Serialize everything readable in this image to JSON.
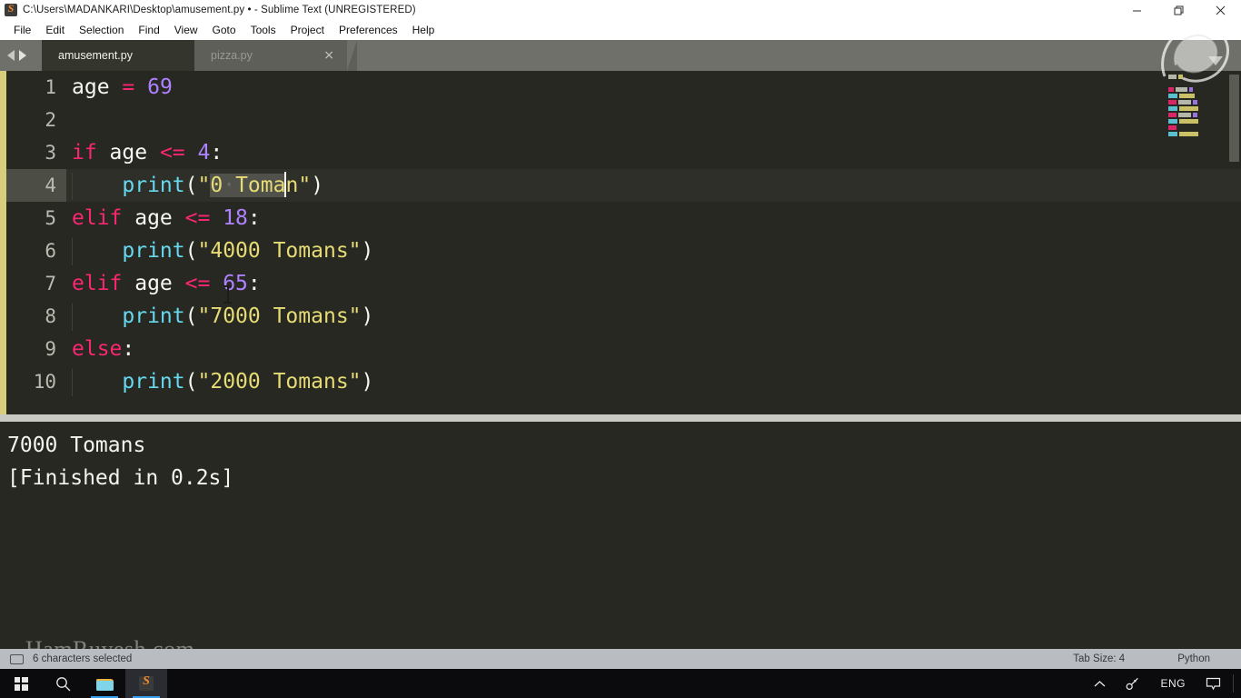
{
  "window": {
    "title": "C:\\Users\\MADANKARI\\Desktop\\amusement.py • - Sublime Text (UNREGISTERED)",
    "app_icon": "sublime-text-icon",
    "controls": {
      "minimize": "minimize-icon",
      "restore": "restore-icon",
      "close": "close-icon"
    }
  },
  "menubar": {
    "items": [
      {
        "label": "File"
      },
      {
        "label": "Edit"
      },
      {
        "label": "Selection"
      },
      {
        "label": "Find"
      },
      {
        "label": "View"
      },
      {
        "label": "Goto"
      },
      {
        "label": "Tools"
      },
      {
        "label": "Project"
      },
      {
        "label": "Preferences"
      },
      {
        "label": "Help"
      }
    ]
  },
  "tabbar": {
    "nav": {
      "prev": "arrow-left-icon",
      "next": "arrow-right-icon"
    },
    "tabs": [
      {
        "label": "amusement.py",
        "active": true,
        "modified": true,
        "close_glyph": ""
      },
      {
        "label": "pizza.py",
        "active": false,
        "modified": false,
        "close_glyph": "×"
      }
    ]
  },
  "editor": {
    "current_line": 4,
    "lines": [
      {
        "n": "1",
        "tokens": [
          {
            "t": "age",
            "c": "pl"
          },
          {
            "t": " ",
            "c": "pl"
          },
          {
            "t": "=",
            "c": "op"
          },
          {
            "t": " ",
            "c": "pl"
          },
          {
            "t": "69",
            "c": "num"
          }
        ]
      },
      {
        "n": "2",
        "tokens": []
      },
      {
        "n": "3",
        "tokens": [
          {
            "t": "if",
            "c": "kw"
          },
          {
            "t": " age ",
            "c": "pl"
          },
          {
            "t": "<=",
            "c": "op"
          },
          {
            "t": " ",
            "c": "pl"
          },
          {
            "t": "4",
            "c": "num"
          },
          {
            "t": ":",
            "c": "pl"
          }
        ]
      },
      {
        "n": "4",
        "tokens": [
          {
            "t": "    ",
            "c": "pl"
          },
          {
            "t": "print",
            "c": "fn"
          },
          {
            "t": "(",
            "c": "pl"
          },
          {
            "t": "\"",
            "c": "str"
          },
          {
            "t": "0",
            "c": "str sel"
          },
          {
            "t": "·",
            "c": "spacedot sel"
          },
          {
            "t": "Toma",
            "c": "str sel"
          },
          {
            "t": "CARET",
            "c": "caret"
          },
          {
            "t": "n",
            "c": "str"
          },
          {
            "t": "\"",
            "c": "str"
          },
          {
            "t": ")",
            "c": "pl"
          }
        ]
      },
      {
        "n": "5",
        "tokens": [
          {
            "t": "elif",
            "c": "kw"
          },
          {
            "t": " age ",
            "c": "pl"
          },
          {
            "t": "<=",
            "c": "op"
          },
          {
            "t": " ",
            "c": "pl"
          },
          {
            "t": "18",
            "c": "num"
          },
          {
            "t": ":",
            "c": "pl"
          }
        ]
      },
      {
        "n": "6",
        "tokens": [
          {
            "t": "    ",
            "c": "pl"
          },
          {
            "t": "print",
            "c": "fn"
          },
          {
            "t": "(",
            "c": "pl"
          },
          {
            "t": "\"4000 Tomans\"",
            "c": "str"
          },
          {
            "t": ")",
            "c": "pl"
          }
        ]
      },
      {
        "n": "7",
        "tokens": [
          {
            "t": "elif",
            "c": "kw"
          },
          {
            "t": " age ",
            "c": "pl"
          },
          {
            "t": "<=",
            "c": "op"
          },
          {
            "t": " ",
            "c": "pl"
          },
          {
            "t": "65",
            "c": "num"
          },
          {
            "t": ":",
            "c": "pl"
          }
        ]
      },
      {
        "n": "8",
        "tokens": [
          {
            "t": "    ",
            "c": "pl"
          },
          {
            "t": "print",
            "c": "fn"
          },
          {
            "t": "(",
            "c": "pl"
          },
          {
            "t": "\"7000 Tomans\"",
            "c": "str"
          },
          {
            "t": ")",
            "c": "pl"
          }
        ]
      },
      {
        "n": "9",
        "tokens": [
          {
            "t": "else",
            "c": "kw"
          },
          {
            "t": ":",
            "c": "pl"
          }
        ]
      },
      {
        "n": "10",
        "tokens": [
          {
            "t": "    ",
            "c": "pl"
          },
          {
            "t": "print",
            "c": "fn"
          },
          {
            "t": "(",
            "c": "pl"
          },
          {
            "t": "\"2000 Tomans\"",
            "c": "str"
          },
          {
            "t": ")",
            "c": "pl"
          }
        ]
      }
    ],
    "minimap": [
      [
        {
          "w": 9,
          "c": "#cfcfc2"
        },
        {
          "w": 5,
          "c": "#e6db74"
        }
      ],
      [],
      [
        {
          "w": 6,
          "c": "#f92672"
        },
        {
          "w": 13,
          "c": "#cfcfc2"
        },
        {
          "w": 4,
          "c": "#ae81ff"
        }
      ],
      [
        {
          "w": 10,
          "c": "#66d9ef"
        },
        {
          "w": 17,
          "c": "#e6db74"
        }
      ],
      [
        {
          "w": 9,
          "c": "#f92672"
        },
        {
          "w": 14,
          "c": "#cfcfc2"
        },
        {
          "w": 5,
          "c": "#ae81ff"
        }
      ],
      [
        {
          "w": 10,
          "c": "#66d9ef"
        },
        {
          "w": 21,
          "c": "#e6db74"
        }
      ],
      [
        {
          "w": 9,
          "c": "#f92672"
        },
        {
          "w": 14,
          "c": "#cfcfc2"
        },
        {
          "w": 5,
          "c": "#ae81ff"
        }
      ],
      [
        {
          "w": 10,
          "c": "#66d9ef"
        },
        {
          "w": 21,
          "c": "#e6db74"
        }
      ],
      [
        {
          "w": 9,
          "c": "#f92672"
        }
      ],
      [
        {
          "w": 10,
          "c": "#66d9ef"
        },
        {
          "w": 21,
          "c": "#e6db74"
        }
      ]
    ]
  },
  "output": {
    "lines": [
      "7000 Tomans",
      "[Finished in 0.2s]"
    ]
  },
  "watermark": {
    "text": "HamRuyesh.com",
    "swirl": "swirl-logo-icon"
  },
  "statusbar": {
    "panel_icon": "console-panel-icon",
    "left_text": "6 characters selected",
    "tab_size": "Tab Size: 4",
    "syntax": "Python"
  },
  "taskbar": {
    "start": "windows-start-icon",
    "search": "search-icon",
    "apps": [
      {
        "name": "file-explorer-icon",
        "active": false,
        "running": true
      },
      {
        "name": "sublime-text-icon",
        "active": true,
        "running": true
      }
    ],
    "tray": {
      "chevron": "chevron-up-icon",
      "pen": "pen-icon",
      "language": "ENG",
      "notifications": "notification-icon"
    }
  },
  "colors": {
    "editor_bg": "#272822",
    "keyword": "#f92672",
    "number": "#ae81ff",
    "function": "#66d9ef",
    "string": "#e6db74",
    "plain": "#f8f8f2",
    "selection": "#50514a",
    "accent_strip": "#d6ce7a"
  }
}
